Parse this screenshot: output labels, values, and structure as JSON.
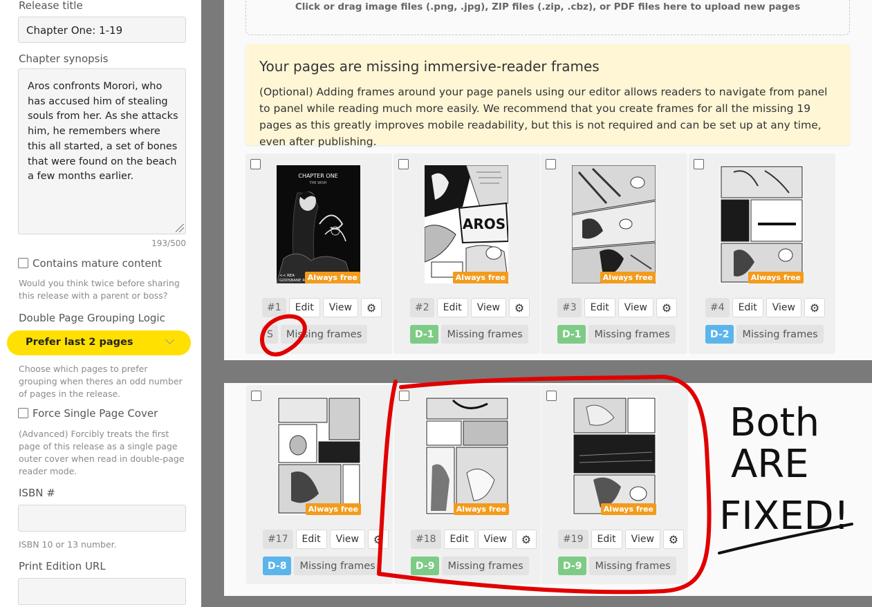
{
  "sidebar": {
    "release_title_label": "Release title",
    "release_title_value": "Chapter One: 1-19",
    "synopsis_label": "Chapter synopsis",
    "synopsis_value": "Aros confronts Morori, who has accused him of stealing souls from her. As she attacks him, he remembers where this all started, a set of bones that were found on the beach a few months earlier.",
    "synopsis_counter": "193/500",
    "mature_label": "Contains mature content",
    "mature_help": "Would you think twice before sharing this release with a parent or boss?",
    "grouping_label": "Double Page Grouping Logic",
    "grouping_value": "Prefer last 2 pages",
    "grouping_help": "Choose which pages to prefer grouping when theres an odd number of pages in the release.",
    "force_cover_label": "Force Single Page Cover",
    "force_cover_help": "(Advanced) Forcibly treats the first page of this release as a single page outer cover when read in double-page reader mode.",
    "isbn_label": "ISBN #",
    "isbn_value": "",
    "isbn_help": "ISBN 10 or 13 number.",
    "print_url_label": "Print Edition URL",
    "print_url_value": ""
  },
  "upload": {
    "text": "Click or drag image files (.png, .jpg), ZIP files (.zip, .cbz), or PDF files here to upload new pages"
  },
  "notice": {
    "title": "Your pages are missing immersive-reader frames",
    "body": "(Optional) Adding frames around your page panels using our editor allows readers to navigate from panel to panel while reading much more easily. We recommend that you create frames for all the missing 19 pages as this greatly improves mobile readability, but this is not required and can be set up at any time, even after publishing."
  },
  "labels": {
    "edit": "Edit",
    "view": "View",
    "always_free": "Always free",
    "missing_frames": "Missing frames",
    "gear_glyph": "⚙"
  },
  "cover_text": {
    "chapter": "CHAPTER ONE",
    "subtitle": "THE WISH",
    "read": "<< REA",
    "brand": "GODSBANE R"
  },
  "pages": [
    {
      "num": "#1",
      "group": "S",
      "group_color": "#e2e2e2",
      "group_text_color": "#666"
    },
    {
      "num": "#2",
      "group": "D-1",
      "group_color": "#7ecb86",
      "group_text_color": "#ffffff"
    },
    {
      "num": "#3",
      "group": "D-1",
      "group_color": "#7ecb86",
      "group_text_color": "#ffffff"
    },
    {
      "num": "#4",
      "group": "D-2",
      "group_color": "#5bb5ec",
      "group_text_color": "#ffffff"
    },
    {
      "num": "#17",
      "group": "D-8",
      "group_color": "#5bb5ec",
      "group_text_color": "#ffffff"
    },
    {
      "num": "#18",
      "group": "D-9",
      "group_color": "#7ecb86",
      "group_text_color": "#ffffff"
    },
    {
      "num": "#19",
      "group": "D-9",
      "group_color": "#7ecb86",
      "group_text_color": "#ffffff"
    }
  ],
  "annotation": {
    "line1": "Both",
    "line2": "ARE",
    "line3": "FIXED!",
    "color": "#e00000"
  }
}
